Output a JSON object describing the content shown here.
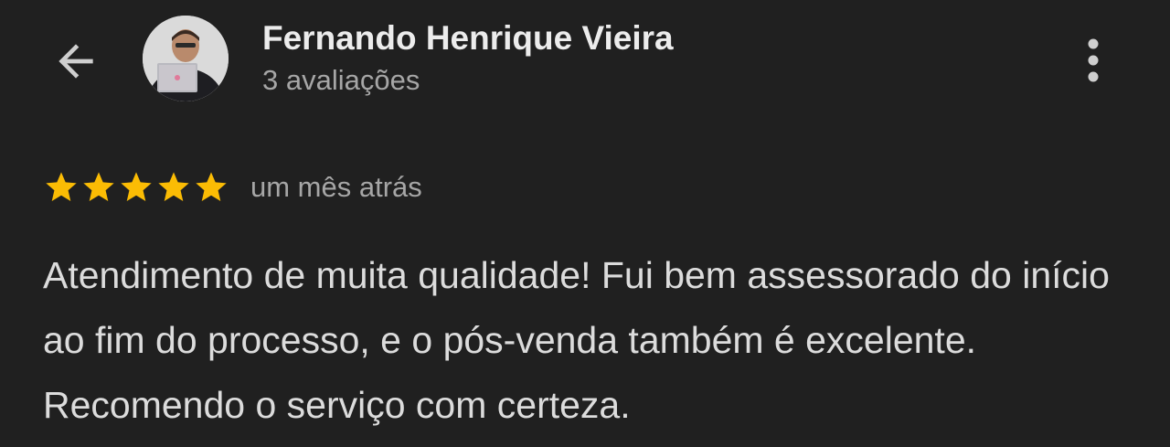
{
  "header": {
    "back_icon": "arrow-left-icon",
    "avatar_icon": "profile-photo",
    "reviewer_name": "Fernando Henrique Vieira",
    "review_count": "3 avaliações",
    "more_icon": "more-vert-icon"
  },
  "review": {
    "rating": 5,
    "rating_max": 5,
    "star_icon": "star-icon",
    "star_color": "#FBBC04",
    "date": "um mês atrás",
    "text": "Atendimento de muita qualidade! Fui bem assessorado do início ao fim do processo, e o pós-venda também é excelente. Recomendo o serviço com certeza."
  },
  "colors": {
    "background": "#202020",
    "primary_text": "#ececec",
    "secondary_text": "#a6a6a6"
  }
}
